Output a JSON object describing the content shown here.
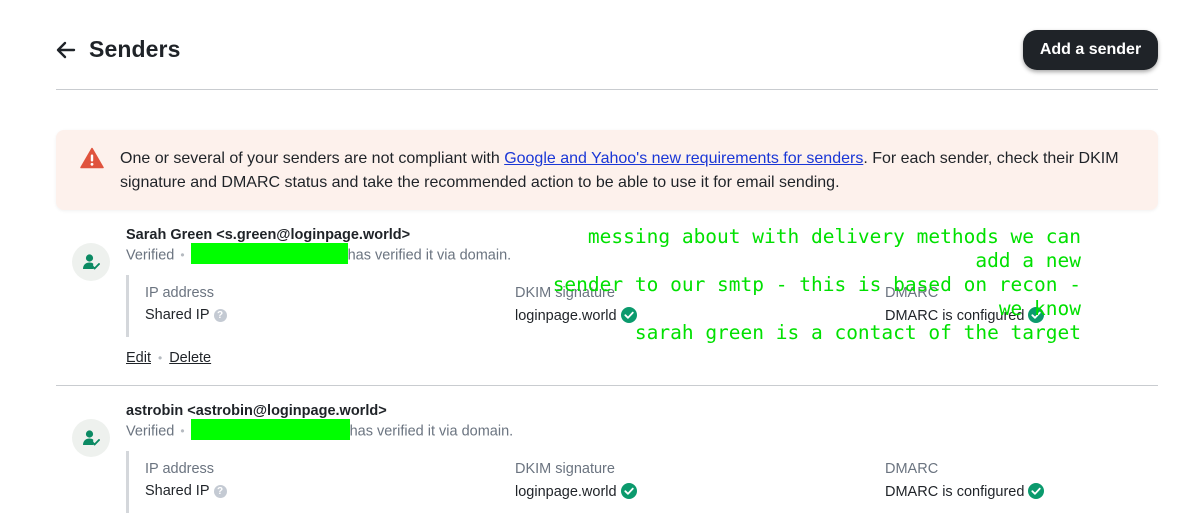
{
  "header": {
    "title": "Senders",
    "add_button_label": "Add a sender"
  },
  "alert": {
    "text_before": "One or several of your senders are not compliant with ",
    "link_text": "Google and Yahoo's new requirements for senders",
    "text_after": ". For each sender, check their DKIM signature and DMARC status and take the recommended action to be able to use it for email sending."
  },
  "columns": {
    "ip_label": "IP address",
    "dkim_label": "DKIM signature",
    "dmarc_label": "DMARC"
  },
  "senders": [
    {
      "name": "Sarah Green <s.green@loginpage.world>",
      "status": "Verified",
      "verified_suffix": "has verified it via domain.",
      "ip_value": "Shared IP",
      "dkim_value": "loginpage.world",
      "dmarc_value": "DMARC is configured",
      "edit_label": "Edit",
      "delete_label": "Delete"
    },
    {
      "name": "astrobin <astrobin@loginpage.world>",
      "status": "Verified",
      "verified_suffix": "has verified it via domain.",
      "ip_value": "Shared IP",
      "dkim_value": "loginpage.world",
      "dmarc_value": "DMARC is configured"
    }
  ],
  "annotation": {
    "line1": "messing about with delivery methods we can add a new",
    "line2": "sender to our smtp - this is based on recon - we know",
    "line3": "sarah green is a contact of the target"
  },
  "colors": {
    "accent_dark": "#1f2328",
    "alert_bg": "#fdf1ec",
    "warning": "#e0533d",
    "success": "#0b9a6d",
    "link": "#1a37d6",
    "redaction": "#00ff00",
    "annotation": "#00e000"
  },
  "icons": {
    "back": "arrow-left-icon",
    "warning": "warning-triangle-icon",
    "avatar": "user-check-icon",
    "help": "question-circle-icon",
    "check": "check-circle-icon"
  }
}
